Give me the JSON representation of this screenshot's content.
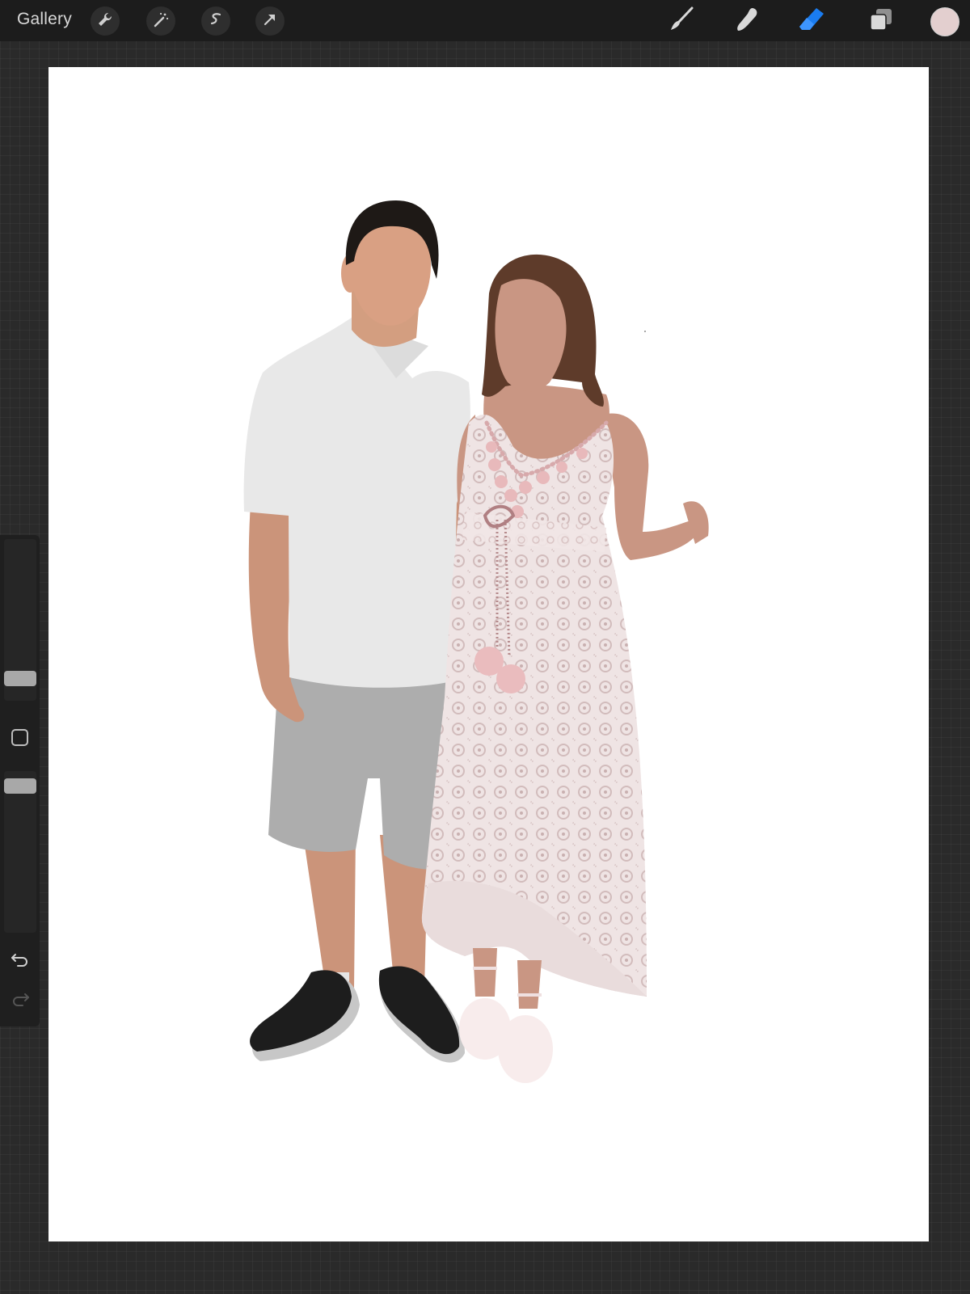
{
  "toolbar": {
    "gallery_label": "Gallery",
    "left_tools": [
      "wrench-icon",
      "magic-wand-icon",
      "selection-icon",
      "transform-arrow-icon"
    ],
    "right_tools": [
      "brush-icon",
      "smudge-icon",
      "eraser-icon",
      "layers-icon"
    ],
    "active_tool": "eraser",
    "accent_color": "#1a7cf0",
    "current_color": "#e3cfcf"
  },
  "sidebar": {
    "brush_size_level": 0.1,
    "opacity_level": 0.95
  },
  "canvas": {
    "background": "#ffffff",
    "subject": "couple-illustration"
  }
}
